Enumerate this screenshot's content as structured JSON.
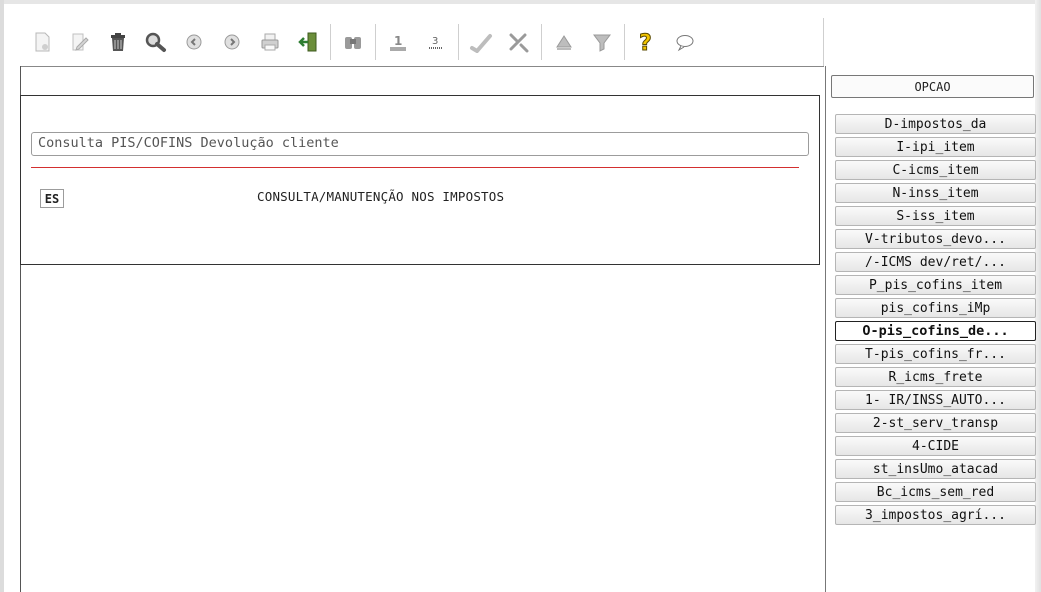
{
  "toolbar": {
    "buttons": [
      {
        "icon": "new-doc-icon"
      },
      {
        "icon": "edit-icon"
      },
      {
        "icon": "trash-icon"
      },
      {
        "icon": "search-icon"
      },
      {
        "icon": "prev-icon"
      },
      {
        "icon": "next-icon"
      },
      {
        "icon": "print-icon"
      },
      {
        "icon": "exit-icon"
      },
      {
        "icon": "binoculars-icon"
      },
      {
        "icon": "spool-1-icon"
      },
      {
        "icon": "spool-3-icon"
      },
      {
        "icon": "confirm-icon"
      },
      {
        "icon": "tools-icon"
      },
      {
        "icon": "up-triangle-icon"
      },
      {
        "icon": "filter-icon"
      },
      {
        "icon": "help-icon"
      },
      {
        "icon": "chat-icon"
      }
    ]
  },
  "form": {
    "description": "Consulta PIS/COFINS Devolução cliente",
    "code": "ES",
    "title": "CONSULTA/MANUTENÇÃO NOS IMPOSTOS"
  },
  "options": {
    "header": "OPCAO",
    "items": [
      "D-impostos_da",
      "I-ipi_item",
      "C-icms_item",
      "N-inss_item",
      "S-iss_item",
      "V-tributos_devo...",
      "/-ICMS dev/ret/...",
      "P_pis_cofins_item",
      "pis_cofins_iMp",
      "O-pis_cofins_de...",
      "T-pis_cofins_fr...",
      "R_icms_frete",
      "1- IR/INSS_AUTO...",
      "2-st_serv_transp",
      "4-CIDE",
      "st_insUmo_atacad",
      "Bc_icms_sem_red",
      "3_impostos_agrí..."
    ],
    "selected_index": 9
  },
  "colors": {
    "accent_red": "#d32f2f",
    "help_yellow": "#f2c400"
  }
}
